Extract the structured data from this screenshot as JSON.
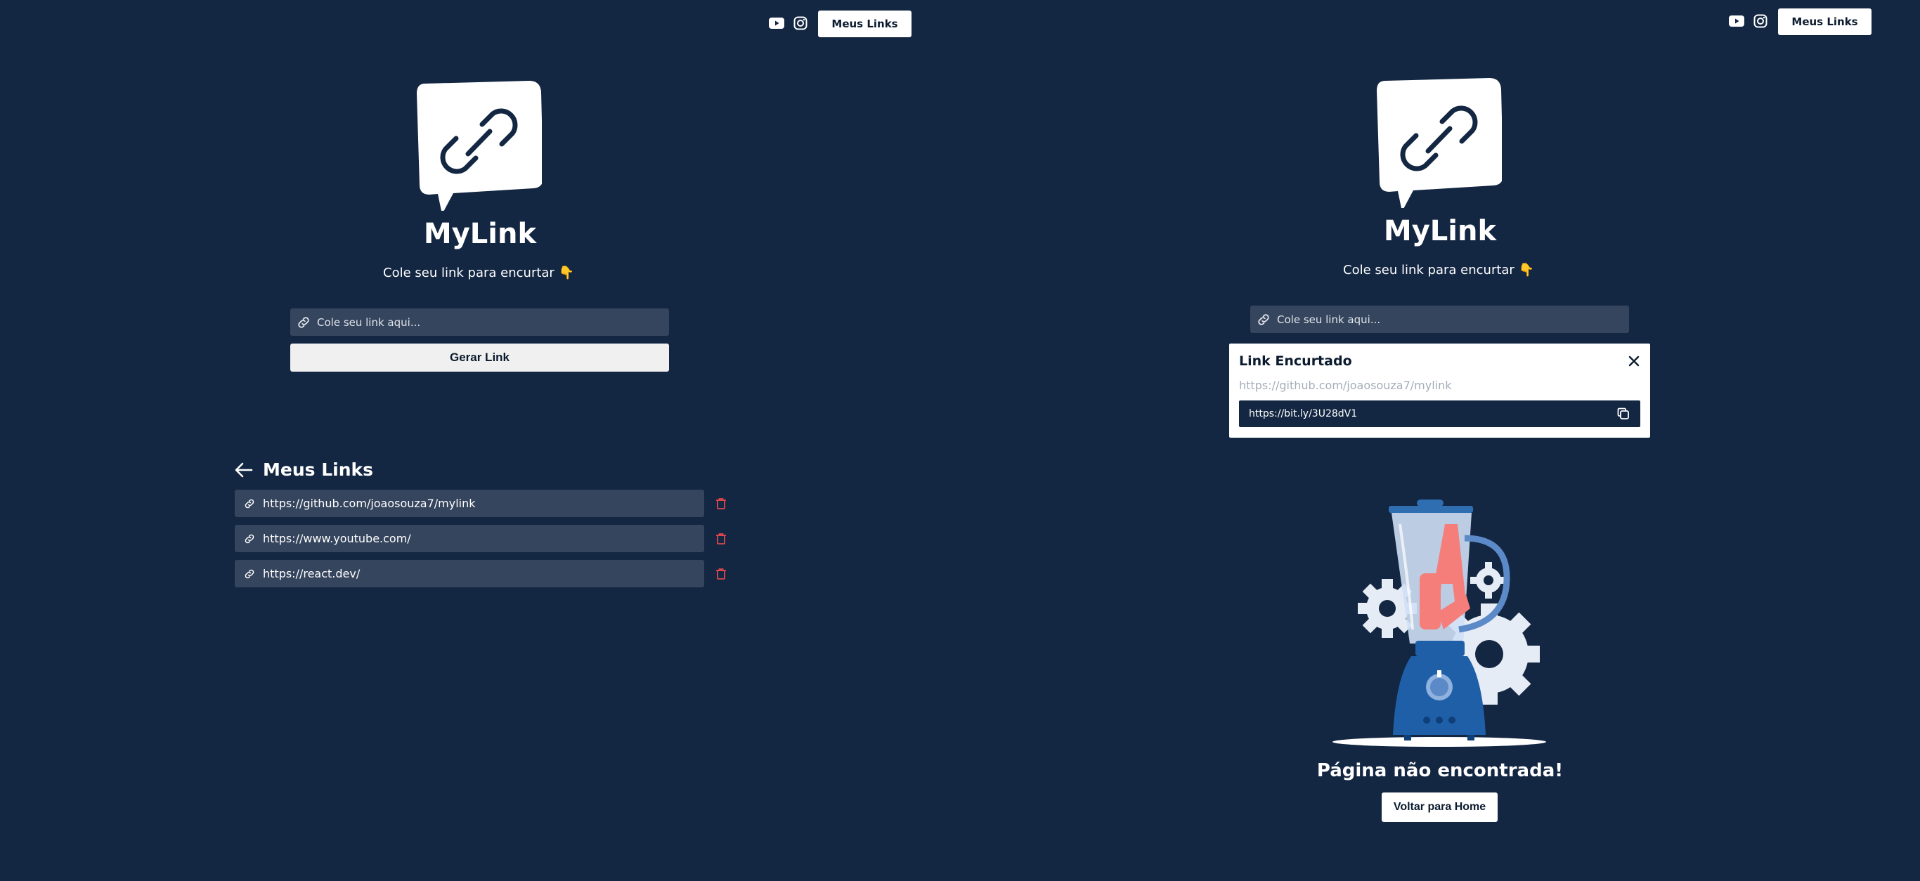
{
  "header": {
    "nav_button_label": "Meus Links",
    "icons": [
      "youtube-icon",
      "instagram-icon"
    ]
  },
  "home": {
    "brand": "MyLink",
    "subtitle": "Cole seu link para encurtar 👇",
    "input_placeholder": "Cole seu link aqui...",
    "generate_label": "Gerar Link"
  },
  "my_links": {
    "title": "Meus Links",
    "items": [
      {
        "url": "https://github.com/joaosouza7/mylink"
      },
      {
        "url": "https://www.youtube.com/"
      },
      {
        "url": "https://react.dev/"
      }
    ]
  },
  "modal": {
    "title": "Link Encurtado",
    "original_url": "https://github.com/joaosouza7/mylink",
    "short_url": "https://bit.ly/3U28dV1"
  },
  "not_found": {
    "title": "Página não encontrada!",
    "button_label": "Voltar para Home"
  },
  "colors": {
    "background": "#132642",
    "input_bg": "#36455e",
    "delete": "#e0474c",
    "accent_pink": "#f57e7b"
  }
}
